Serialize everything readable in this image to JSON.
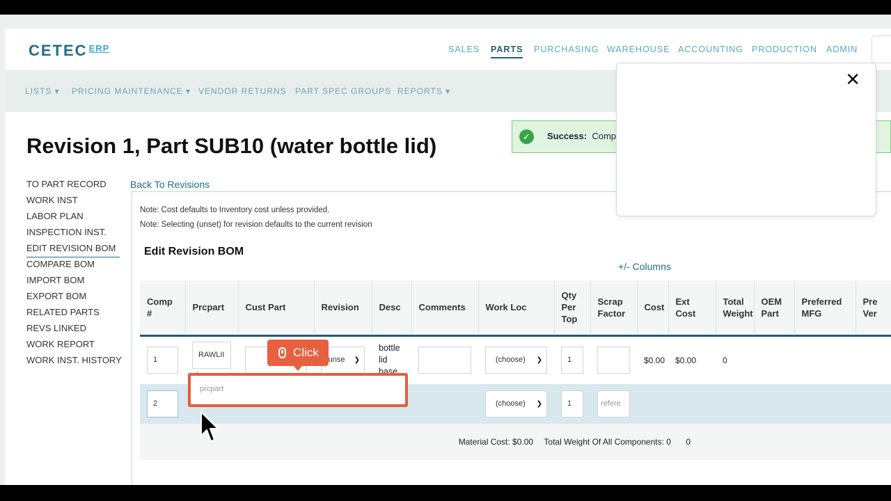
{
  "app": {
    "logo_main": "CETEC",
    "logo_suffix": "ERP"
  },
  "nav": [
    {
      "label": "SALES",
      "active": false
    },
    {
      "label": "PARTS",
      "active": true
    },
    {
      "label": "PURCHASING",
      "active": false
    },
    {
      "label": "WAREHOUSE",
      "active": false
    },
    {
      "label": "ACCOUNTING",
      "active": false
    },
    {
      "label": "PRODUCTION",
      "active": false
    },
    {
      "label": "ADMIN",
      "active": false
    }
  ],
  "subnav": [
    {
      "label": "LISTS ▾"
    },
    {
      "label": "PRICING MAINTENANCE ▾"
    },
    {
      "label": "VENDOR RETURNS"
    },
    {
      "label": "PART SPEC GROUPS"
    },
    {
      "label": "REPORTS ▾"
    }
  ],
  "page_title": "Revision 1, Part SUB10 (water bottle lid)",
  "sidebar": [
    {
      "label": "TO PART RECORD"
    },
    {
      "label": "WORK INST"
    },
    {
      "label": "LABOR PLAN"
    },
    {
      "label": "INSPECTION INST."
    },
    {
      "label": "EDIT REVISION BOM",
      "current": true
    },
    {
      "label": "COMPARE BOM"
    },
    {
      "label": "IMPORT BOM"
    },
    {
      "label": "EXPORT BOM"
    },
    {
      "label": "RELATED PARTS"
    },
    {
      "label": "REVS LINKED"
    },
    {
      "label": "WORK REPORT"
    },
    {
      "label": "WORK INST. HISTORY"
    }
  ],
  "back_link": "Back To Revisions",
  "notes": [
    "Note: Cost defaults to Inventory cost unless provided.",
    "Note: Selecting (unset) for revision defaults to the current revision"
  ],
  "bom_title": "Edit Revision BOM",
  "columns_toggle": "+/- Columns",
  "table": {
    "headers": [
      "Comp #",
      "Prcpart",
      "Cust Part",
      "Revision",
      "Desc",
      "Comments",
      "Work Loc",
      "Qty Per Top",
      "Scrap Factor",
      "Cost",
      "Ext Cost",
      "Total Weight",
      "OEM Part",
      "Preferred MFG",
      "Pre Ver"
    ],
    "row1": {
      "comp": "1",
      "prcpart": "RAWLII",
      "add": "+",
      "revision": "(unse",
      "desc": "bottle lid base",
      "workloc": "(choose)",
      "qty": "1",
      "cost": "$0.00",
      "ext_cost": "$0.00",
      "weight": "0"
    },
    "row2": {
      "comp": "2",
      "prcpart_placeholder": "prcpart",
      "workloc": "(choose)",
      "qty": "1",
      "scrap_placeholder": "refere"
    },
    "footer": {
      "material_cost": "Material Cost: $0.00",
      "total_weight": "Total Weight Of All Components: 0",
      "extra": "0"
    }
  },
  "success": {
    "label": "Success:",
    "message": "Compo"
  },
  "modal": {
    "close": "✕"
  },
  "overlay": {
    "click_label": "Click"
  },
  "colors": {
    "accent": "#1f6f86",
    "highlight": "#e65c3e",
    "success_bg": "#e0f4df"
  }
}
